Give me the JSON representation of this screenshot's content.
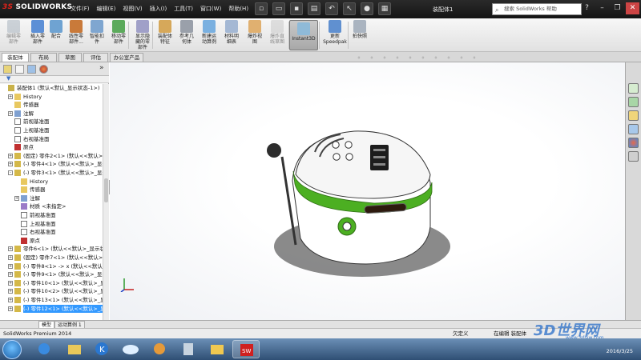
{
  "app": {
    "logo_ds": "3S",
    "logo_name": "SOLIDWORKS",
    "document_title": "装配体1",
    "search_placeholder": "搜索 SolidWorks 帮助"
  },
  "menu": [
    "文件(F)",
    "编辑(E)",
    "视图(V)",
    "插入(I)",
    "工具(T)",
    "窗口(W)",
    "帮助(H)"
  ],
  "ribbon": {
    "buttons": [
      {
        "label": "编辑零\n部件",
        "dim": true
      },
      {
        "label": "插入零\n部件",
        "dim": false
      },
      {
        "label": "配合",
        "dim": false
      },
      {
        "label": "线性零\n部件...",
        "dim": false
      },
      {
        "label": "智能扣\n件",
        "dim": false
      },
      {
        "label": "移动零\n部件",
        "dim": false
      },
      {
        "label": "显示隐\n藏的零\n部件",
        "dim": false
      },
      {
        "label": "装配体\n特征",
        "dim": false
      },
      {
        "label": "参考几\n何体",
        "dim": false
      },
      {
        "label": "新建运\n动算例",
        "dim": false
      },
      {
        "label": "材料明\n细表",
        "dim": false
      },
      {
        "label": "爆炸视\n图",
        "dim": false
      },
      {
        "label": "爆炸直\n线草图",
        "dim": true
      },
      {
        "label": "Instant3D",
        "dim": false
      },
      {
        "label": "更新\nSpeedpak",
        "dim": false
      },
      {
        "label": "拍快照",
        "dim": false
      }
    ]
  },
  "command_tabs": [
    "装配体",
    "布局",
    "草图",
    "评估",
    "办公室产品"
  ],
  "tree": [
    {
      "indent": 0,
      "exp": "",
      "label": "装配体1  (默认<默认_显示状态-1>)",
      "icon": "asm"
    },
    {
      "indent": 1,
      "exp": "+",
      "label": "History",
      "icon": "folder"
    },
    {
      "indent": 1,
      "exp": "",
      "label": "传感器",
      "icon": "folder"
    },
    {
      "indent": 1,
      "exp": "+",
      "label": "注解",
      "icon": "note"
    },
    {
      "indent": 1,
      "exp": "",
      "label": "前视基准面",
      "icon": "plane"
    },
    {
      "indent": 1,
      "exp": "",
      "label": "上视基准面",
      "icon": "plane"
    },
    {
      "indent": 1,
      "exp": "",
      "label": "右视基准面",
      "icon": "plane"
    },
    {
      "indent": 1,
      "exp": "",
      "label": "原点",
      "icon": "origin"
    },
    {
      "indent": 1,
      "exp": "+",
      "label": "(固定) 零件2<1> (默认<<默认>_显示状态 1>)",
      "icon": "part"
    },
    {
      "indent": 1,
      "exp": "+",
      "label": "(-) 零件4<1> (默认<<默认>_显示状态 1>)",
      "icon": "part"
    },
    {
      "indent": 1,
      "exp": "-",
      "label": "(-) 零件3<1> (默认<<默认>_显示状态 1>)",
      "icon": "part"
    },
    {
      "indent": 2,
      "exp": "",
      "label": "History",
      "icon": "folder"
    },
    {
      "indent": 2,
      "exp": "",
      "label": "传感器",
      "icon": "folder"
    },
    {
      "indent": 2,
      "exp": "+",
      "label": "注解",
      "icon": "note"
    },
    {
      "indent": 2,
      "exp": "",
      "label": "材质 <未指定>",
      "icon": "material"
    },
    {
      "indent": 2,
      "exp": "",
      "label": "前视基准面",
      "icon": "plane"
    },
    {
      "indent": 2,
      "exp": "",
      "label": "上视基准面",
      "icon": "plane"
    },
    {
      "indent": 2,
      "exp": "",
      "label": "右视基准面",
      "icon": "plane"
    },
    {
      "indent": 2,
      "exp": "",
      "label": "原点",
      "icon": "origin"
    },
    {
      "indent": 1,
      "exp": "+",
      "label": "零件6<1> (默认<<默认>_显示状态 1>)",
      "icon": "part"
    },
    {
      "indent": 1,
      "exp": "+",
      "label": "(固定) 零件7<1> (默认<<默认>_显示状态 1>)",
      "icon": "part"
    },
    {
      "indent": 1,
      "exp": "+",
      "label": "(-) 零件8<1> -> x (默认<<默认>_显示状态 1>)",
      "icon": "part"
    },
    {
      "indent": 1,
      "exp": "+",
      "label": "(-) 零件9<1> (默认<<默认>_显示状态 1>)",
      "icon": "part"
    },
    {
      "indent": 1,
      "exp": "+",
      "label": "(-) 零件10<1> (默认<<默认>_显示状态 1>)",
      "icon": "part"
    },
    {
      "indent": 1,
      "exp": "+",
      "label": "(-) 零件10<2> (默认<<默认>_显示状态 1>)",
      "icon": "part"
    },
    {
      "indent": 1,
      "exp": "+",
      "label": "(-) 零件13<1> (默认<<默认>_显示状态 1>)",
      "icon": "part"
    },
    {
      "indent": 1,
      "exp": "+",
      "label": "(-) 零件12<1> (默认<<默认>_显示状态 1>)",
      "icon": "part",
      "selected": true
    }
  ],
  "model_tabs": [
    "模型",
    "运动算例 1"
  ],
  "status": {
    "product": "SolidWorks Premium 2014",
    "state1": "欠定义",
    "state2": "在编辑 装配体"
  },
  "taskbar": {
    "date": "2016/3/25"
  },
  "watermark": {
    "text": "3D世界网",
    "sub": "www.3dsjw.com"
  },
  "colors": {
    "accent_green": "#4caf22",
    "selection": "#3399ff",
    "close": "#cc4444"
  }
}
